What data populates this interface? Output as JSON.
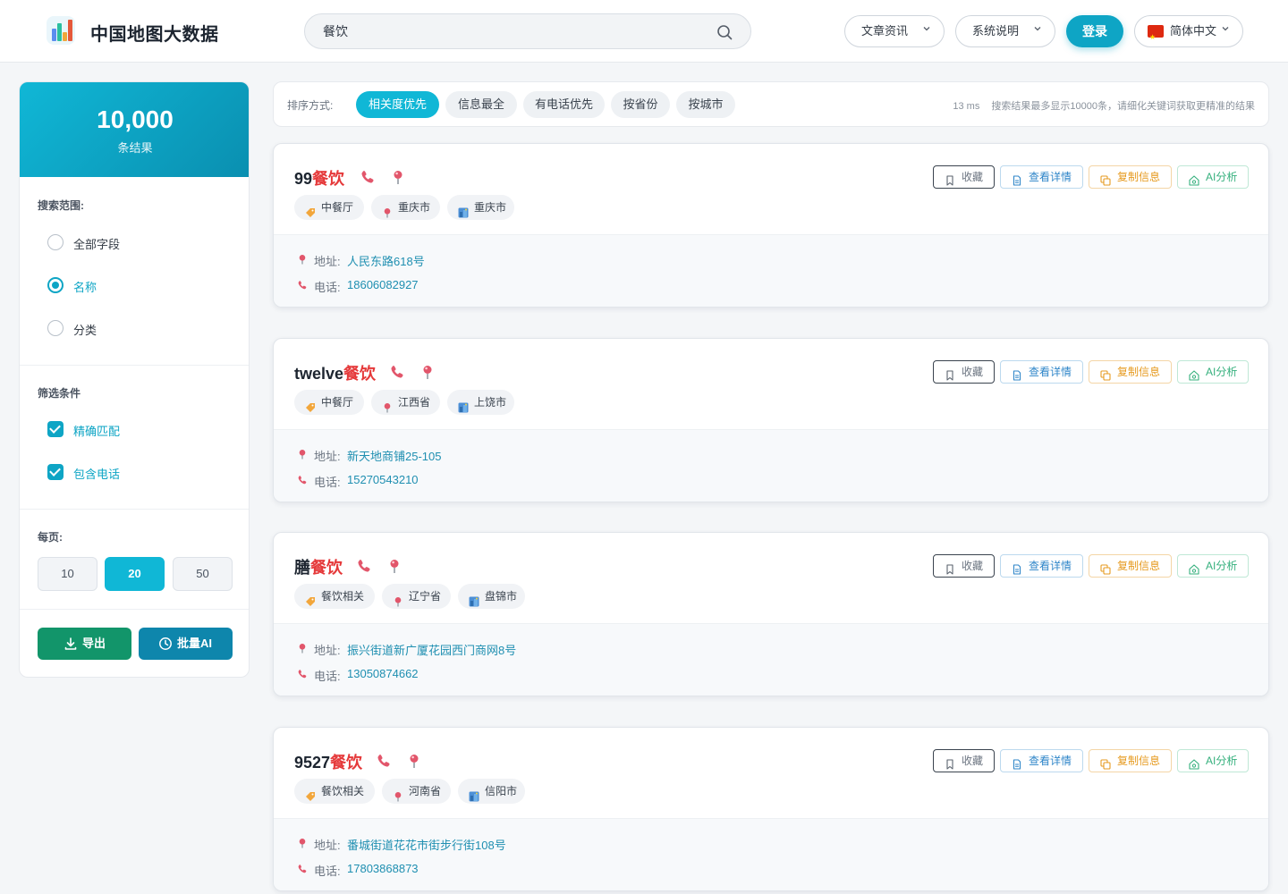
{
  "header": {
    "app_title": "中国地图大数据",
    "search_value": "餐饮",
    "articles_label": "文章资讯",
    "docs_label": "系统说明",
    "login_label": "登录",
    "language_label": "简体中文"
  },
  "sidebar": {
    "result_count": "10,000",
    "result_label": "条结果",
    "scope_title": "搜索范围:",
    "scope_options": [
      "全部字段",
      "名称",
      "分类"
    ],
    "scope_selected": "名称",
    "filter_title": "筛选条件",
    "filters": [
      {
        "label": "精确匹配",
        "checked": true
      },
      {
        "label": "包含电话",
        "checked": true
      }
    ],
    "per_page_title": "每页:",
    "per_page_options": [
      "10",
      "20",
      "50"
    ],
    "per_page_selected": "20",
    "export_label": "导出",
    "batch_ai_label": "批量AI"
  },
  "sortbar": {
    "label": "排序方式:",
    "options": [
      "相关度优先",
      "信息最全",
      "有电话优先",
      "按省份",
      "按城市"
    ],
    "selected": "相关度优先",
    "elapsed": "13 ms",
    "notice": "搜索结果最多显示10000条，请细化关键词获取更精准的结果"
  },
  "card_actions": {
    "favorite": "收藏",
    "details": "查看详情",
    "copy": "复制信息",
    "ai": "AI分析",
    "address_key": "地址:",
    "phone_key": "电话:"
  },
  "results": [
    {
      "name_prefix": "99",
      "name_highlight": "餐饮",
      "name_suffix": "",
      "category": "中餐厅",
      "province": "重庆市",
      "city": "重庆市",
      "address": "人民东路618号",
      "phone": "18606082927"
    },
    {
      "name_prefix": "twelve",
      "name_highlight": "餐饮",
      "name_suffix": "",
      "category": "中餐厅",
      "province": "江西省",
      "city": "上饶市",
      "address": "新天地商铺25-105",
      "phone": "15270543210"
    },
    {
      "name_prefix": "膳",
      "name_highlight": "餐饮",
      "name_suffix": "",
      "category": "餐饮相关",
      "province": "辽宁省",
      "city": "盘锦市",
      "address": "振兴街道新广厦花园西门商网8号",
      "phone": "13050874662"
    },
    {
      "name_prefix": "9527",
      "name_highlight": "餐饮",
      "name_suffix": "",
      "category": "餐饮相关",
      "province": "河南省",
      "city": "信阳市",
      "address": "番城街道花花市街步行街108号",
      "phone": "17803868873"
    }
  ],
  "colors": {
    "accent": "#10b7d6",
    "highlight": "#e5393a",
    "export_green": "#12956a",
    "batch_blue": "#0e86ac"
  },
  "icons": [
    "chart-logo-icon",
    "search-icon",
    "chevron-down-icon",
    "china-flag-icon",
    "download-icon",
    "clock-icon",
    "phone-icon",
    "map-pin-icon",
    "tag-icon",
    "city-icon",
    "bookmark-icon",
    "document-icon",
    "copy-icon",
    "ai-robot-icon"
  ]
}
